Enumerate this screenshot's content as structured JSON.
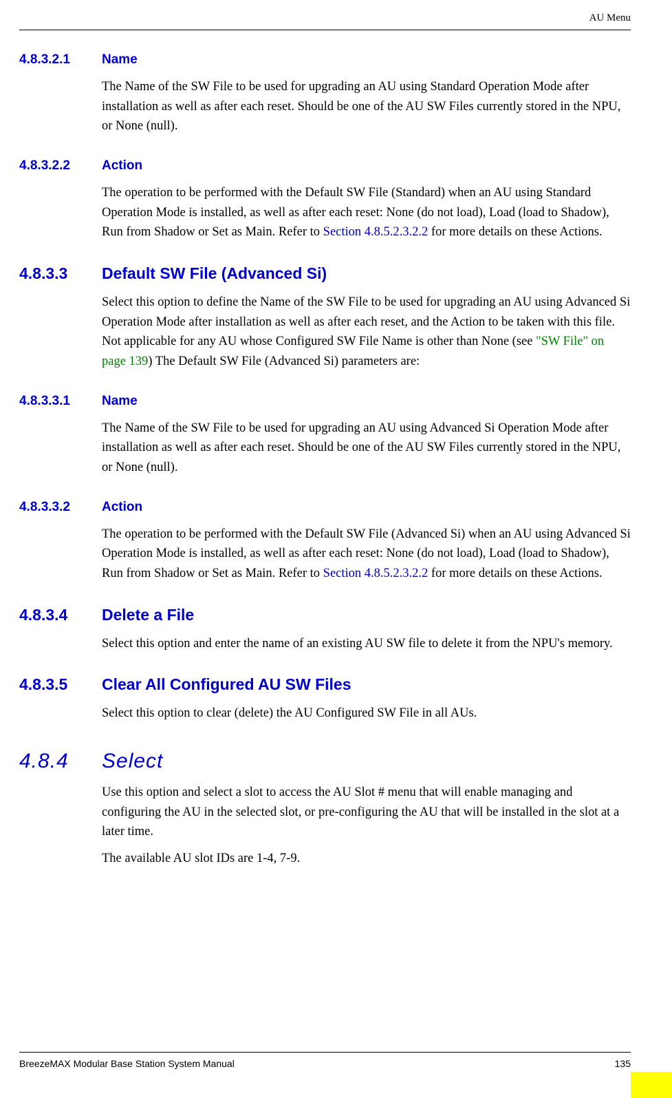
{
  "header": {
    "title": "AU Menu"
  },
  "sections": [
    {
      "num": "4.8.3.2.1",
      "title": "Name",
      "body": "The Name of the SW File to be used for upgrading an AU using Standard Operation Mode after installation as well as after each reset. Should be one of the AU SW Files currently stored in the NPU, or None (null)."
    },
    {
      "num": "4.8.3.2.2",
      "title": "Action",
      "body_pre": "The operation to be performed with the Default SW File (Standard) when an AU using Standard Operation Mode is installed, as well as after each reset: None (do not load), Load (load to Shadow), Run from Shadow or Set as Main. Refer to ",
      "xref": "Section 4.8.5.2.3.2.2",
      "body_post": " for more details on these Actions."
    },
    {
      "num": "4.8.3.3",
      "title": "Default SW File (Advanced Si)",
      "body_pre": "Select this option to define the Name of the SW File to be used for upgrading an AU using Advanced Si Operation Mode after installation as well as after each reset, and the Action to be taken with this file. Not applicable for any AU whose Configured SW File Name is other than None (see ",
      "green_ref": "\"SW File\" on page 139",
      "body_post": ") The Default SW File (Advanced Si) parameters are:"
    },
    {
      "num": "4.8.3.3.1",
      "title": "Name",
      "body": "The Name of the SW File to be used for upgrading an AU using Advanced Si Operation Mode after installation as well as after each reset. Should be one of the AU SW Files currently stored in the NPU, or None (null)."
    },
    {
      "num": "4.8.3.3.2",
      "title": "Action",
      "body_pre": "The operation to be performed with the Default SW File (Advanced Si) when an AU using Advanced Si Operation Mode is installed, as well as after each reset: None (do not load), Load (load to Shadow), Run from Shadow or Set as Main. Refer to ",
      "xref": "Section 4.8.5.2.3.2.2",
      "body_post": " for more details on these Actions."
    },
    {
      "num": "4.8.3.4",
      "title": "Delete a File",
      "body": "Select this option and enter the name of an existing AU SW file to delete it from the NPU's memory."
    },
    {
      "num": "4.8.3.5",
      "title": "Clear All Configured AU SW Files",
      "body": "Select this option to clear (delete) the AU Configured SW File in all AUs."
    },
    {
      "num": "4.8.4",
      "title": "Select",
      "body": "Use this option and select a slot to access the AU Slot # menu that will enable managing and configuring the AU in the selected slot, or pre-configuring the AU that will be installed in the slot at a later time.",
      "body2": "The available AU slot IDs are 1-4, 7-9."
    }
  ],
  "footer": {
    "left": "BreezeMAX Modular Base Station System Manual",
    "right": "135"
  }
}
